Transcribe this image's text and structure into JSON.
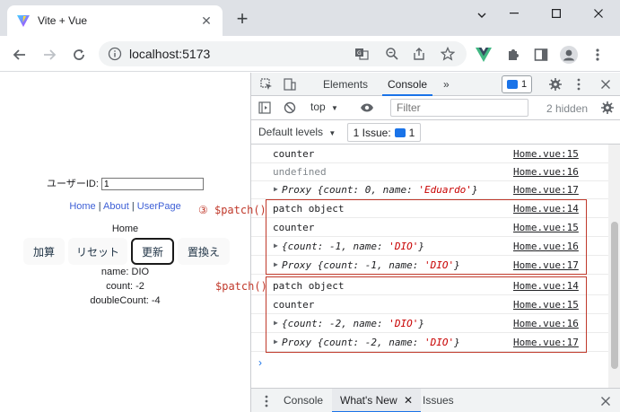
{
  "browser": {
    "tab_title": "Vite + Vue",
    "url": "localhost:5173"
  },
  "page": {
    "user_label": "ユーザーID:",
    "user_value": "1",
    "nav": {
      "home": "Home",
      "sep": " | ",
      "about": "About",
      "userpage": "UserPage"
    },
    "home_title": "Home",
    "buttons": [
      "加算",
      "リセット",
      "更新",
      "置換え"
    ],
    "name_line": "name: DIO",
    "count_line": "count: -2",
    "double_line": "doubleCount: -4"
  },
  "devtools": {
    "tabs": [
      "Elements",
      "Console"
    ],
    "more_tabs": "»",
    "message_count": "1",
    "context": "top",
    "filter_placeholder": "Filter",
    "hidden": "2 hidden",
    "levels": "Default levels",
    "issues": "1 Issue:",
    "issues_count": "1",
    "console_rows": [
      {
        "text": "counter",
        "src": "Home.vue:15"
      },
      {
        "text": "undefined",
        "src": "Home.vue:16"
      },
      {
        "prefix": "Proxy {count: 0, name: ",
        "str": "'Eduardo'",
        "suffix": "}",
        "src": "Home.vue:17"
      },
      {
        "text": "patch object",
        "src": "Home.vue:14"
      },
      {
        "text": "counter",
        "src": "Home.vue:15"
      },
      {
        "prefix": "{count: -1, name: ",
        "str": "'DIO'",
        "suffix": "}",
        "src": "Home.vue:16"
      },
      {
        "prefix": "Proxy {count: -1, name: ",
        "str": "'DIO'",
        "suffix": "}",
        "src": "Home.vue:17"
      },
      {
        "text": "patch object",
        "src": "Home.vue:14"
      },
      {
        "text": "counter",
        "src": "Home.vue:15"
      },
      {
        "prefix": "{count: -2, name: ",
        "str": "'DIO'",
        "suffix": "}",
        "src": "Home.vue:16"
      },
      {
        "prefix": "Proxy {count: -2, name: ",
        "str": "'DIO'",
        "suffix": "}",
        "src": "Home.vue:17"
      }
    ],
    "annotation_1": "③ $patch()",
    "annotation_2": "$patch()",
    "prompt": "›",
    "drawer_tabs": [
      "Console",
      "What's New",
      "Issues"
    ]
  },
  "colors": {
    "annotation": "#c0392b",
    "accent": "#1a73e8",
    "link": "#3d5fd6"
  }
}
